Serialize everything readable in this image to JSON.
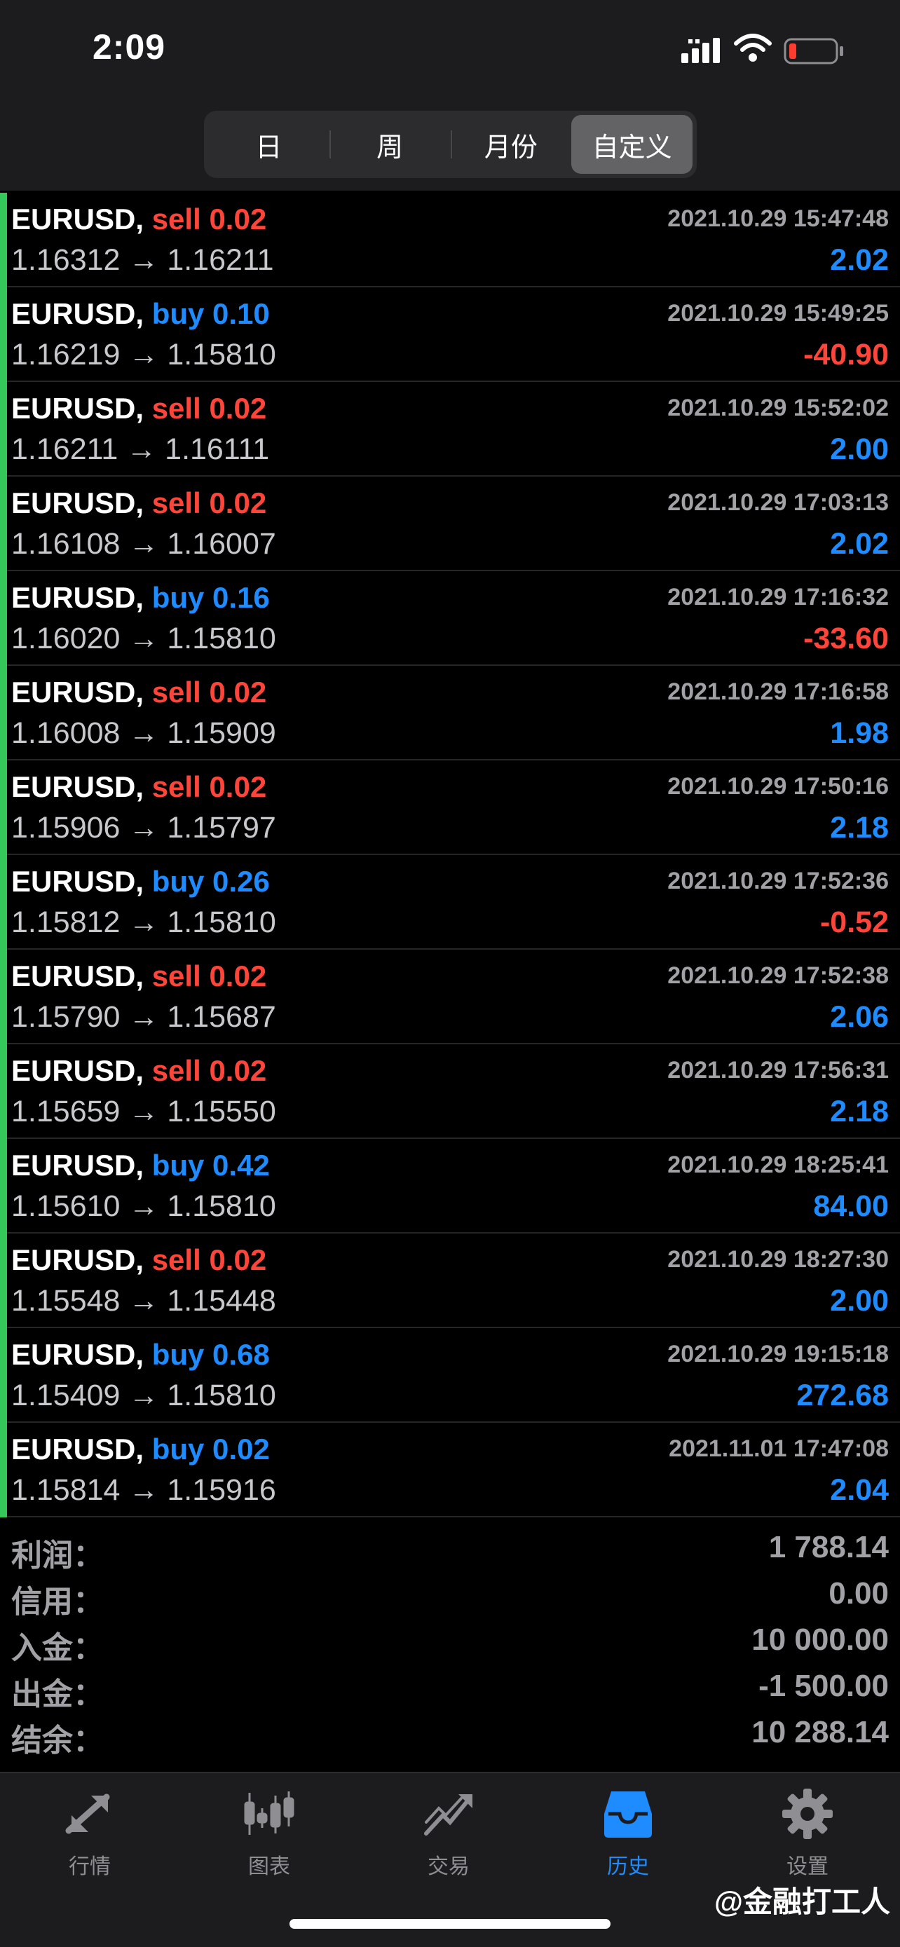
{
  "status_bar": {
    "time": "2:09"
  },
  "periods": {
    "tabs": [
      "日",
      "周",
      "月份",
      "自定义"
    ],
    "active": "自定义"
  },
  "deals": [
    {
      "symbol": "EURUSD,",
      "type": "sell",
      "volume": "0.02",
      "open": "1.16312",
      "close": "1.16211",
      "time": "2021.10.29 15:47:48",
      "profit": "2.02",
      "sign": "pos"
    },
    {
      "symbol": "EURUSD,",
      "type": "buy",
      "volume": "0.10",
      "open": "1.16219",
      "close": "1.15810",
      "time": "2021.10.29 15:49:25",
      "profit": "-40.90",
      "sign": "neg"
    },
    {
      "symbol": "EURUSD,",
      "type": "sell",
      "volume": "0.02",
      "open": "1.16211",
      "close": "1.16111",
      "time": "2021.10.29 15:52:02",
      "profit": "2.00",
      "sign": "pos"
    },
    {
      "symbol": "EURUSD,",
      "type": "sell",
      "volume": "0.02",
      "open": "1.16108",
      "close": "1.16007",
      "time": "2021.10.29 17:03:13",
      "profit": "2.02",
      "sign": "pos"
    },
    {
      "symbol": "EURUSD,",
      "type": "buy",
      "volume": "0.16",
      "open": "1.16020",
      "close": "1.15810",
      "time": "2021.10.29 17:16:32",
      "profit": "-33.60",
      "sign": "neg"
    },
    {
      "symbol": "EURUSD,",
      "type": "sell",
      "volume": "0.02",
      "open": "1.16008",
      "close": "1.15909",
      "time": "2021.10.29 17:16:58",
      "profit": "1.98",
      "sign": "pos"
    },
    {
      "symbol": "EURUSD,",
      "type": "sell",
      "volume": "0.02",
      "open": "1.15906",
      "close": "1.15797",
      "time": "2021.10.29 17:50:16",
      "profit": "2.18",
      "sign": "pos"
    },
    {
      "symbol": "EURUSD,",
      "type": "buy",
      "volume": "0.26",
      "open": "1.15812",
      "close": "1.15810",
      "time": "2021.10.29 17:52:36",
      "profit": "-0.52",
      "sign": "neg"
    },
    {
      "symbol": "EURUSD,",
      "type": "sell",
      "volume": "0.02",
      "open": "1.15790",
      "close": "1.15687",
      "time": "2021.10.29 17:52:38",
      "profit": "2.06",
      "sign": "pos"
    },
    {
      "symbol": "EURUSD,",
      "type": "sell",
      "volume": "0.02",
      "open": "1.15659",
      "close": "1.15550",
      "time": "2021.10.29 17:56:31",
      "profit": "2.18",
      "sign": "pos"
    },
    {
      "symbol": "EURUSD,",
      "type": "buy",
      "volume": "0.42",
      "open": "1.15610",
      "close": "1.15810",
      "time": "2021.10.29 18:25:41",
      "profit": "84.00",
      "sign": "pos"
    },
    {
      "symbol": "EURUSD,",
      "type": "sell",
      "volume": "0.02",
      "open": "1.15548",
      "close": "1.15448",
      "time": "2021.10.29 18:27:30",
      "profit": "2.00",
      "sign": "pos"
    },
    {
      "symbol": "EURUSD,",
      "type": "buy",
      "volume": "0.68",
      "open": "1.15409",
      "close": "1.15810",
      "time": "2021.10.29 19:15:18",
      "profit": "272.68",
      "sign": "pos"
    },
    {
      "symbol": "EURUSD,",
      "type": "buy",
      "volume": "0.02",
      "open": "1.15814",
      "close": "1.15916",
      "time": "2021.11.01 17:47:08",
      "profit": "2.04",
      "sign": "pos"
    }
  ],
  "arrow": "→",
  "summary": [
    {
      "label": "利润：",
      "value": "1 788.14"
    },
    {
      "label": "信用：",
      "value": "0.00"
    },
    {
      "label": "入金：",
      "value": "10 000.00"
    },
    {
      "label": "出金：",
      "value": "-1 500.00"
    },
    {
      "label": "结余：",
      "value": "10 288.14"
    }
  ],
  "tabbar": [
    {
      "label": "行情",
      "icon": "quotes-arrows-icon"
    },
    {
      "label": "图表",
      "icon": "candlestick-chart-icon"
    },
    {
      "label": "交易",
      "icon": "trade-trend-icon"
    },
    {
      "label": "历史",
      "icon": "history-inbox-icon",
      "active": true
    },
    {
      "label": "设置",
      "icon": "gear-icon"
    }
  ],
  "watermark": "@金融打工人",
  "colors": {
    "sell": "#ff453a",
    "buy": "#1e8cff",
    "row_marker": "#34c759",
    "tab_active": "#1e8cff"
  }
}
